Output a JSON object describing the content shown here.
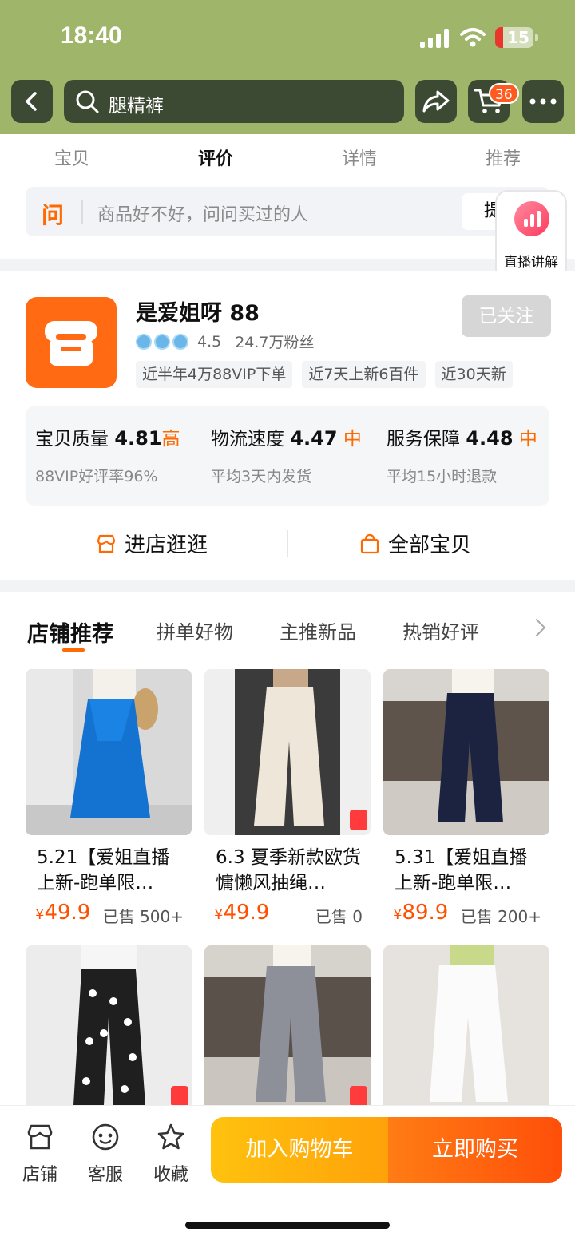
{
  "status_bar": {
    "time": "18:40",
    "battery": "15"
  },
  "header": {
    "search_query": "腿精裤",
    "cart_count": "36"
  },
  "tabs": [
    "宝贝",
    "评价",
    "详情",
    "推荐"
  ],
  "ask": {
    "icon_text": "问",
    "placeholder": "商品好不好，问问买过的人",
    "button": "提问"
  },
  "live_float": {
    "label": "直播讲解"
  },
  "shop": {
    "name": "是爱姐呀 88",
    "rating": "4.5",
    "fans": "24.7万粉丝",
    "follow": "已关注",
    "chips": [
      "近半年4万88VIP下单",
      "近7天上新6百件",
      "近30天新"
    ],
    "metrics": [
      {
        "label": "宝贝质量",
        "score": "4.81",
        "level": "高",
        "sub": "88VIP好评率96%"
      },
      {
        "label": "物流速度",
        "score": "4.47",
        "level": "中",
        "sub": "平均3天内发货"
      },
      {
        "label": "服务保障",
        "score": "4.48",
        "level": "中",
        "sub": "平均15小时退款"
      }
    ],
    "enter_shop": "进店逛逛",
    "all_items": "全部宝贝"
  },
  "rec_tabs": [
    "店铺推荐",
    "拼单好物",
    "主推新品",
    "热销好评"
  ],
  "products": [
    {
      "title": "5.21【爱姐直播上新-跑单限…",
      "price": "49.9",
      "sold": "已售 500+"
    },
    {
      "title": "6.3 夏季新款欧货慵懒风抽绳…",
      "price": "49.9",
      "sold": "已售 0"
    },
    {
      "title": "5.31【爱姐直播上新-跑单限…",
      "price": "89.9",
      "sold": "已售 200+"
    }
  ],
  "bottom": {
    "store": "店铺",
    "service": "客服",
    "favorite": "收藏",
    "add_cart": "加入购物车",
    "buy_now": "立即购买"
  },
  "currency": "¥",
  "colors": {
    "accent": "#ff6a00",
    "price": "#ff5000",
    "header_bg": "#9fb56a"
  }
}
